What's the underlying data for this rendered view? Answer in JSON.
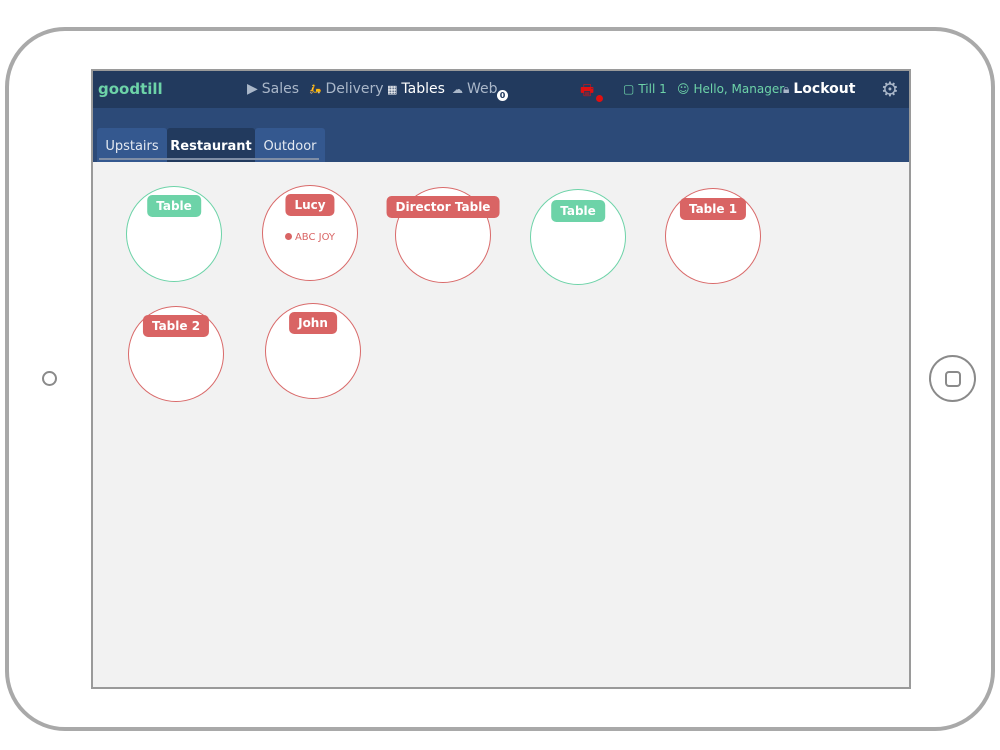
{
  "header": {
    "logo": "goodtill",
    "nav": [
      {
        "label": "Sales",
        "icon": "play-icon"
      },
      {
        "label": "Delivery",
        "icon": "scooter-icon"
      },
      {
        "label": "Tables",
        "icon": "grid-icon"
      },
      {
        "label": "Web",
        "icon": "cloud-icon"
      }
    ],
    "web_badge": "0",
    "till": "Till 1",
    "greeting": "Hello, Manager",
    "lockout": "Lockout"
  },
  "tabs": [
    {
      "label": "Upstairs"
    },
    {
      "label": "Restaurant"
    },
    {
      "label": "Outdoor"
    }
  ],
  "tables": [
    {
      "label": "Table",
      "status": "free"
    },
    {
      "label": "Lucy",
      "status": "occupied",
      "customer": "ABC JOY"
    },
    {
      "label": "Director Table",
      "status": "occupied"
    },
    {
      "label": "Table",
      "status": "free"
    },
    {
      "label": "Table 1",
      "status": "occupied"
    },
    {
      "label": "Table 2",
      "status": "occupied"
    },
    {
      "label": "John",
      "status": "occupied"
    }
  ],
  "colors": {
    "header": "#223a5e",
    "accent": "#6dd3a8",
    "occupied": "#d96464"
  }
}
